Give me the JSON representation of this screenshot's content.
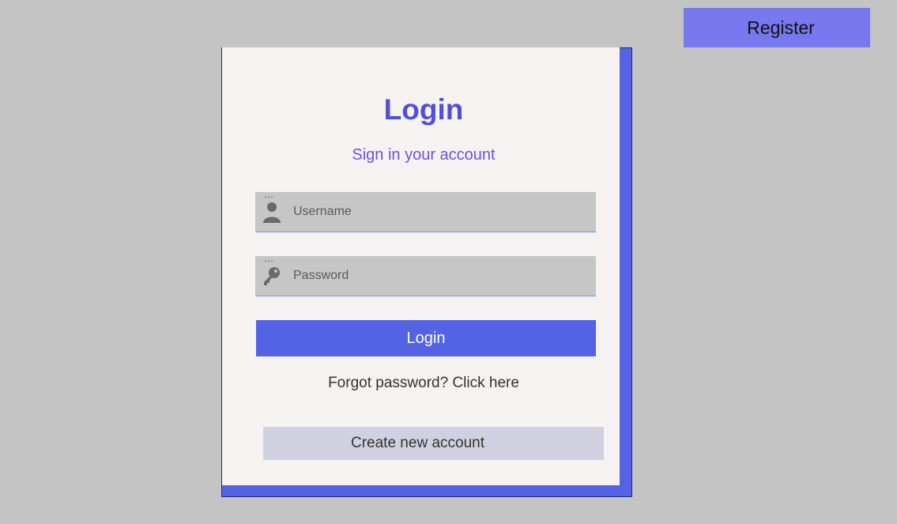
{
  "header": {
    "register_label": "Register"
  },
  "login_card": {
    "title": "Login",
    "subtitle": "Sign in your account",
    "username_placeholder": "Username",
    "password_placeholder": "Password",
    "username_icon": "user-icon",
    "password_icon": "key-icon",
    "login_label": "Login",
    "forgot_text": "Forgot password? Click here",
    "create_account_label": "Create new account"
  },
  "colors": {
    "accent": "#5463e5",
    "title": "#5050d6",
    "register_button": "#7777ee",
    "card_background": "#f7f2f2",
    "page_background": "#c4c4c4"
  }
}
